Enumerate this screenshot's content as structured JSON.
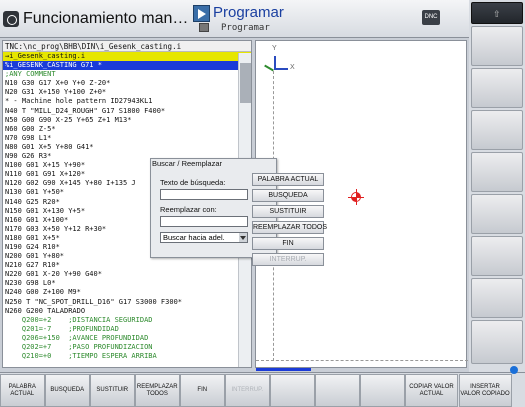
{
  "header": {
    "mode_left_label": "Funcionamiento man…",
    "mode_right_label": "Programar",
    "mode_right_sub": "Programar",
    "dnc_label": "DNC"
  },
  "program": {
    "path": "TNC:\\nc_prog\\BHB\\DIN\\i_Gesenk_casting.i",
    "file_line": "→i_Gesenk_casting.i",
    "lines": [
      {
        "text": "%i_GESENK_CASTING G71 *",
        "style": "sel"
      },
      {
        "text": ";ANY COMMENT",
        "style": "green"
      },
      {
        "text": "N10 G30 G17 X+0 Y+0 Z-20*",
        "style": "n"
      },
      {
        "text": "N20 G31 X+150 Y+100 Z+0*",
        "style": "n"
      },
      {
        "text": "* - Machine hole pattern ID27943KL1",
        "style": "plain"
      },
      {
        "text": "N40 T \"MILL_D24_ROUGH\" G17 S1800 F400*",
        "style": "tool"
      },
      {
        "text": "N50 G00 G90 X-25 Y+65 Z+1 M13*",
        "style": "n"
      },
      {
        "text": "N60 G00 Z-5*",
        "style": "n"
      },
      {
        "text": "N70 G98 L1*",
        "style": "n"
      },
      {
        "text": "N80 G01 X+5 Y+80 G41*",
        "style": "n"
      },
      {
        "text": "N90 G26 R3*",
        "style": "n"
      },
      {
        "text": "N100 G01 X+15 Y+90*",
        "style": "n"
      },
      {
        "text": "N110 G01 G91 X+120*",
        "style": "n"
      },
      {
        "text": "N120 G02 G90 X+145 Y+80 I+135 J",
        "style": "n"
      },
      {
        "text": "N130 G01 Y+50*",
        "style": "n"
      },
      {
        "text": "N140 G25 R20*",
        "style": "n"
      },
      {
        "text": "N150 G01 X+130 Y+5*",
        "style": "n"
      },
      {
        "text": "N160 G01 X+100*",
        "style": "n"
      },
      {
        "text": "N170 G03 X+50 Y+12 R+30*",
        "style": "n"
      },
      {
        "text": "N180 G01 X+5*",
        "style": "n"
      },
      {
        "text": "N190 G24 R10*",
        "style": "n"
      },
      {
        "text": "N200 G01 Y+80*",
        "style": "n"
      },
      {
        "text": "N210 G27 R10*",
        "style": "n"
      },
      {
        "text": "N220 G01 X-20 Y+90 G40*",
        "style": "n"
      },
      {
        "text": "N230 G98 L0*",
        "style": "n"
      },
      {
        "text": "N240 G00 Z+100 M9*",
        "style": "n"
      },
      {
        "text": "N250 T \"NC_SPOT_DRILL_D16\" G17 S3000 F300*",
        "style": "tool"
      },
      {
        "text": "N260 G200 TALADRADO",
        "style": "n"
      },
      {
        "text": "    Q200=+2    ;DISTANCIA SEGURIDAD",
        "style": "q"
      },
      {
        "text": "    Q201=-7    ;PROFUNDIDAD",
        "style": "q"
      },
      {
        "text": "    Q206=+150  ;AVANCE PROFUNDIDAD",
        "style": "q"
      },
      {
        "text": "    Q202=+7    ;PASO PROFUNDIZACION",
        "style": "q"
      },
      {
        "text": "    Q210=+0    ;TIEMPO ESPERA ARRIBA",
        "style": "q"
      }
    ]
  },
  "graphics": {
    "axis_y": "Y",
    "axis_x": "X"
  },
  "dialog": {
    "title": "Buscar / Reemplazar",
    "search_label": "Texto de búsqueda:",
    "search_value": "",
    "replace_label": "Reemplazar con:",
    "replace_value": "",
    "direction_value": "Buscar hacia adel.",
    "buttons": [
      "PALABRA ACTUAL",
      "BUSQUEDA",
      "SUSTITUIR",
      "REEMPLAZAR TODOS",
      "FIN",
      "INTERRUP."
    ]
  },
  "softkeys": [
    {
      "label": "PALABRA ACTUAL",
      "enabled": true
    },
    {
      "label": "BUSQUEDA",
      "enabled": true
    },
    {
      "label": "SUSTITUIR",
      "enabled": true
    },
    {
      "label": "REEMPLAZAR TODOS",
      "enabled": true
    },
    {
      "label": "FIN",
      "enabled": true
    },
    {
      "label": "INTERRUP.",
      "enabled": false
    },
    {
      "label": "",
      "enabled": true
    },
    {
      "label": "",
      "enabled": true
    },
    {
      "label": "",
      "enabled": true
    },
    {
      "label": "COPIAR VALOR ACTUAL",
      "enabled": true
    },
    {
      "label": "INSERTAR VALOR COPIADO",
      "enabled": true
    }
  ],
  "colors": {
    "selection": "#1a3bd8",
    "file_highlight": "#e6e600",
    "comment": "#2e8b2e",
    "address": "#1b3fbd",
    "feed": "#d07a00",
    "target": "#e02020"
  }
}
